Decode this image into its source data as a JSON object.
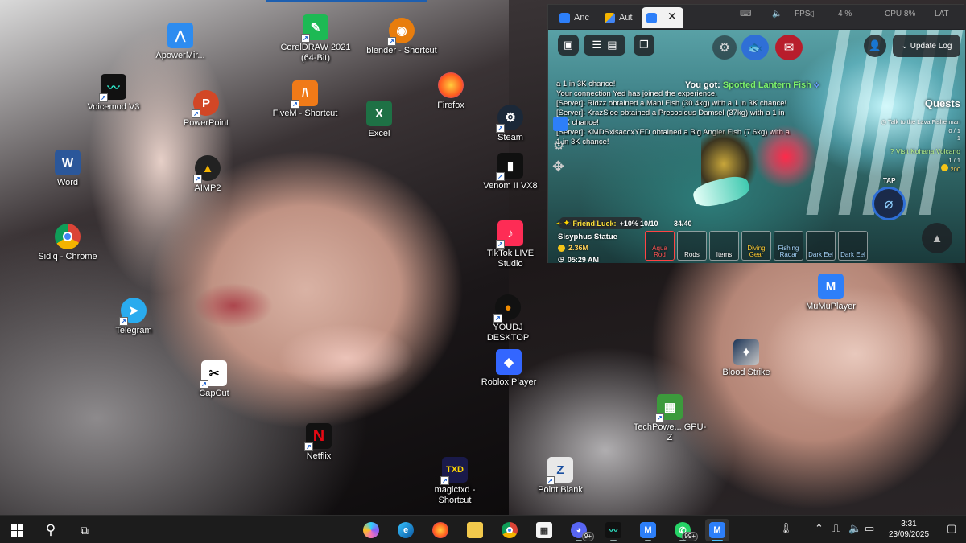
{
  "desktop": {
    "icons": [
      {
        "label": "ApowerMir..."
      },
      {
        "label": "CorelDRAW 2021 (64-Bit)"
      },
      {
        "label": "blender - Shortcut"
      },
      {
        "label": "Voicemod V3"
      },
      {
        "label": "PowerPoint"
      },
      {
        "label": "FiveM - Shortcut"
      },
      {
        "label": "Firefox"
      },
      {
        "label": "Excel"
      },
      {
        "label": "Steam"
      },
      {
        "label": "Word"
      },
      {
        "label": "AIMP2"
      },
      {
        "label": "Venom II VX8"
      },
      {
        "label": "Sidiq - Chrome"
      },
      {
        "label": "TikTok LIVE Studio"
      },
      {
        "label": "Telegram"
      },
      {
        "label": "YOUDJ DESKTOP"
      },
      {
        "label": "CapCut"
      },
      {
        "label": "Roblox Player"
      },
      {
        "label": "MuMuPlayer"
      },
      {
        "label": "Blood Strike"
      },
      {
        "label": "Netflix"
      },
      {
        "label": "TechPowe... GPU-Z"
      },
      {
        "label": "magictxd - Shortcut"
      },
      {
        "label": "Point Blank"
      }
    ]
  },
  "window": {
    "tabs": [
      {
        "label": "Anc"
      },
      {
        "label": "Aut"
      },
      {
        "label": ""
      }
    ],
    "tray": {
      "fps_label": "FPS",
      "cpu_label": "CPU 8%",
      "mem_label": "4 %",
      "lat_label": "LAT"
    }
  },
  "game": {
    "update_log_label": "Update Log",
    "you_got_prefix": "You got:",
    "you_got_fish": "Spotted Lantern Fish",
    "chat": [
      {
        "text": "a 1 in 3K chance!"
      },
      {
        "text": "Your connection Yed has joined the experience."
      },
      {
        "text": "[Server]: Ridzz obtained a Mahi Fish (30.4kg) with a 1 in 3K chance!"
      },
      {
        "text": "[Server]: KrazSloe obtained a Precocious Damsel (37kg) with a 1 in 30K chance!"
      },
      {
        "text": "[Server]: KMDSxlsaccxYED obtained a Big Angler Fish (7.6kg) with a 1 in 3K chance!"
      }
    ],
    "quests": {
      "title": "Quests",
      "q1_label": "Talk to the Lava Fisherman",
      "q1_progress": "0 / 1",
      "q1_count": "1",
      "q2_label": "Visit Kohana Volcano",
      "q2_progress": "1 / 1",
      "q2_reward": "200"
    },
    "tap_label": "TAP",
    "friend_luck_label": "Friend Luck:",
    "friend_luck_value": "+10%",
    "count_a": "10/10",
    "count_b": "34/40",
    "location": "Sisyphus Statue",
    "money": "2.36M",
    "time": "05:29 AM",
    "hotbar": [
      {
        "label": "Aqua Rod"
      },
      {
        "label": "Rods"
      },
      {
        "label": "Items"
      },
      {
        "label": "Diving Gear"
      },
      {
        "label": "Fishing Radar"
      },
      {
        "label": "Dark Eel"
      },
      {
        "label": "Dark Eel"
      }
    ]
  },
  "taskbar": {
    "discord_badge": "9+",
    "whatsapp_badge": "99+",
    "time": "3:31",
    "date": "23/09/2025"
  },
  "colors": {
    "taskbar_bg": "#1c1c1c",
    "accent": "#4cc2ff",
    "quest_title": "#ffffff",
    "you_got_fish": "#7cf26b",
    "chat_highlight": "#bb66ff"
  }
}
